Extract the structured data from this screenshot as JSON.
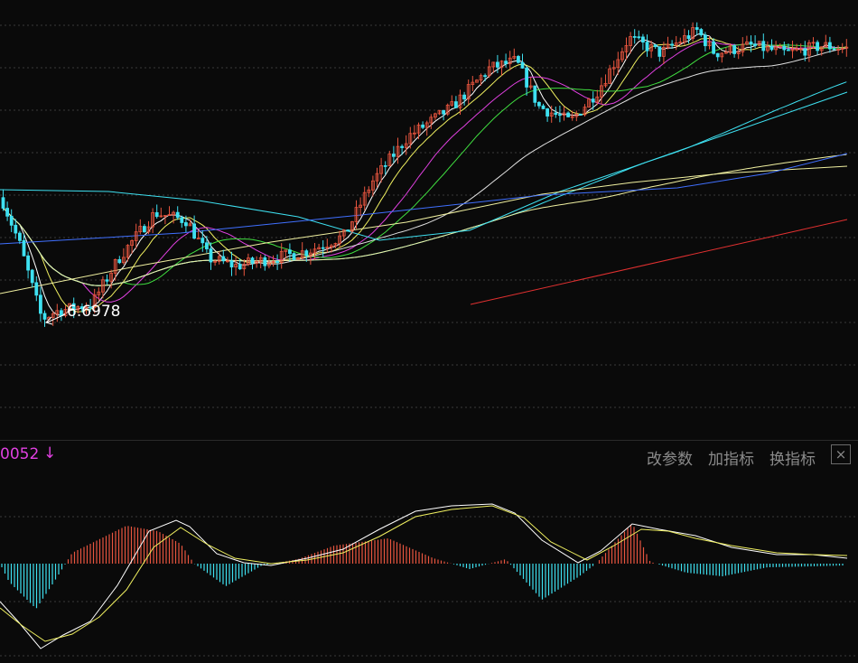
{
  "chart_data": [
    {
      "type": "candlestick",
      "panel": "price",
      "ylim": [
        6.0,
        8.9
      ],
      "grid": true,
      "up_color": "#e8553f",
      "down_color": "#3ee0f0",
      "low_annotation": {
        "text": "6.6978",
        "value": 6.6978
      },
      "moving_average_colors": [
        "#ffffff",
        "#f0f060",
        "#e040e0",
        "#40e040",
        "#e0e0e0",
        "#3ee0f0",
        "#f0f0a0",
        "#4070ff",
        "#e03030"
      ]
    },
    {
      "type": "macd",
      "panel": "indicator",
      "header_value": "0052",
      "trend_arrow": "↓",
      "value_color": "#e040e0",
      "dif_color": "#ffffff",
      "dea_color": "#f0f060",
      "hist_up_color": "#e8553f",
      "hist_down_color": "#3ee0f0"
    }
  ],
  "toolbar": {
    "modify_params": "改参数",
    "add_indicator": "加指标",
    "switch_indicator": "换指标",
    "close": "×"
  }
}
